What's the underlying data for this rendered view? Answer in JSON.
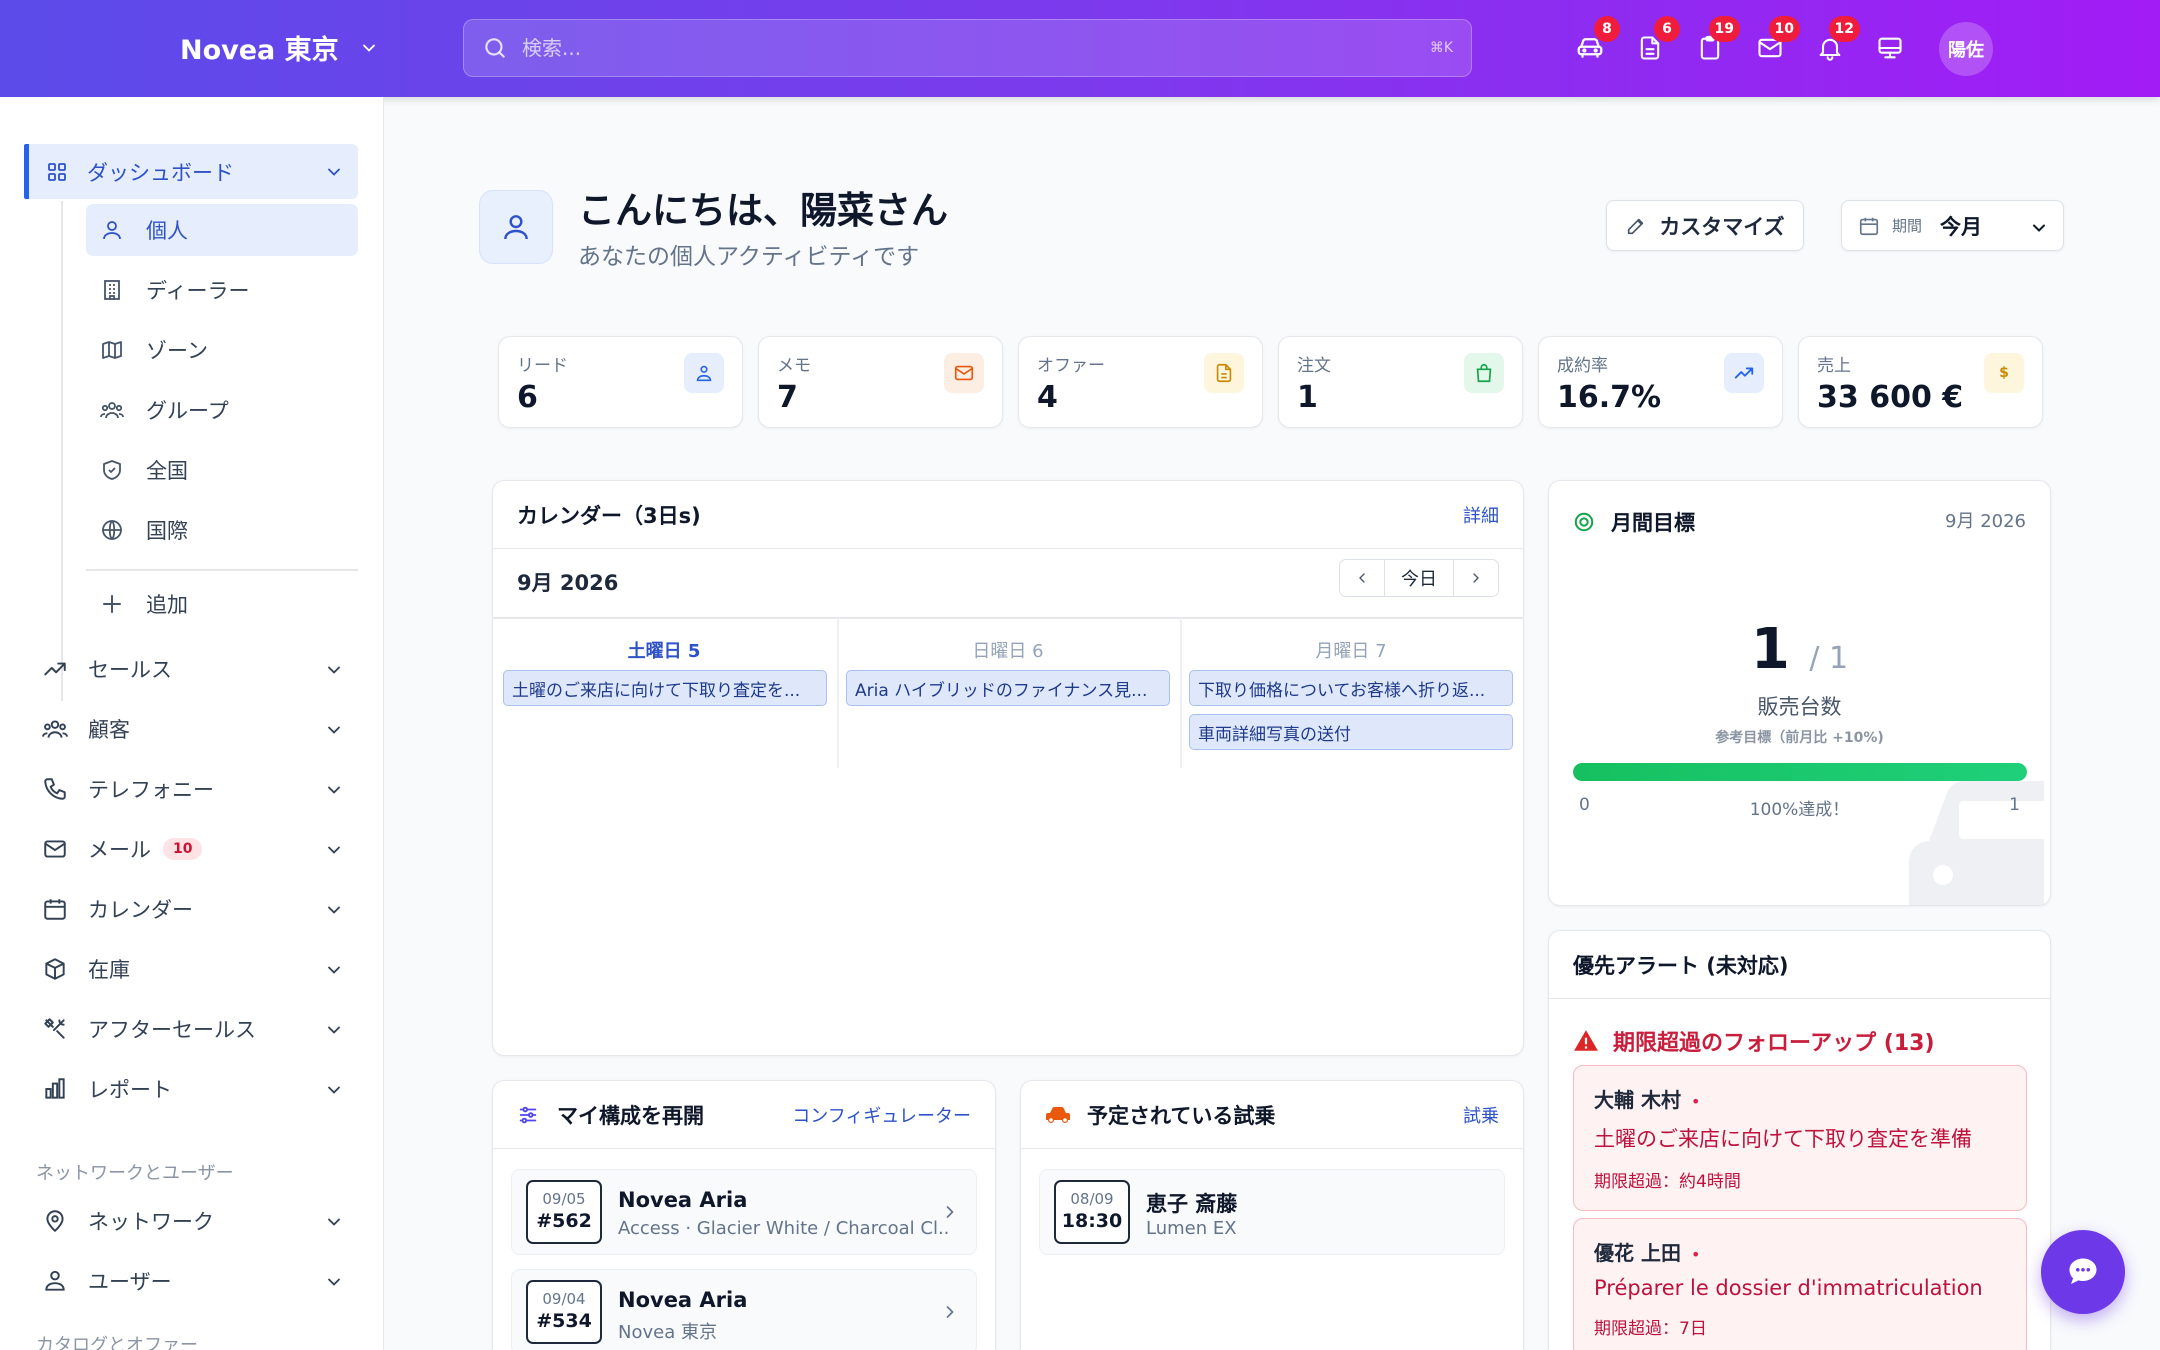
{
  "header": {
    "brand": "Novea 東京",
    "search_placeholder": "検索...",
    "search_kbd": "⌘K",
    "icons": [
      {
        "name": "car-icon",
        "count": "8"
      },
      {
        "name": "document-icon",
        "count": "6"
      },
      {
        "name": "clipboard-icon",
        "count": "19"
      },
      {
        "name": "mail-icon",
        "count": "10"
      },
      {
        "name": "bell-icon",
        "count": "12"
      },
      {
        "name": "monitor-icon",
        "count": ""
      }
    ],
    "user_initials": "陽佐"
  },
  "sidebar": {
    "dashboard": "ダッシュボード",
    "sub_items": [
      "個人",
      "ディーラー",
      "ゾーン",
      "グループ",
      "全国",
      "国際"
    ],
    "add": "追加",
    "nav": [
      "セールス",
      "顧客",
      "テレフォニー",
      "メール",
      "カレンダー",
      "在庫",
      "アフターセールス",
      "レポート"
    ],
    "mail_badge": "10",
    "section_network": "ネットワークとユーザー",
    "network_nav": [
      "ネットワーク",
      "ユーザー"
    ],
    "section_catalog": "カタログとオファー"
  },
  "page": {
    "title": "こんにちは、陽菜さん",
    "subtitle": "あなたの個人アクティビティです",
    "customize": "カスタマイズ",
    "period_label": "期間",
    "period_value": "今月"
  },
  "kpis": [
    {
      "label": "リード",
      "value": "6",
      "color": "#2563eb",
      "bg": "#e6edfc"
    },
    {
      "label": "メモ",
      "value": "7",
      "color": "#ea580c",
      "bg": "#fdeee4"
    },
    {
      "label": "オファー",
      "value": "4",
      "color": "#ca8a04",
      "bg": "#fdf6dc"
    },
    {
      "label": "注文",
      "value": "1",
      "color": "#16a34a",
      "bg": "#e3f7ea"
    },
    {
      "label": "成約率",
      "value": "16.7%",
      "color": "#2563eb",
      "bg": "#e6edfc"
    },
    {
      "label": "売上",
      "value": "33 600 €",
      "color": "#ca8a04",
      "bg": "#fdf6dc"
    }
  ],
  "calendar": {
    "title": "カレンダー（3日s)",
    "link": "詳細",
    "month": "9月 2026",
    "today": "今日",
    "days": [
      "土曜日 5",
      "日曜日 6",
      "月曜日 7"
    ],
    "events": {
      "d0": [
        "土曜のご来店に向けて下取り査定を..."
      ],
      "d1": [
        "Aria ハイブリッドのファイナンス見..."
      ],
      "d2": [
        "下取り価格についてお客様へ折り返...",
        "車両詳細写真の送付"
      ]
    }
  },
  "goal": {
    "title": "月間目標",
    "date": "9月 2026",
    "value": "1",
    "target": "/ 1",
    "label": "販売台数",
    "ref": "参考目標（前月比 +10%)",
    "min": "0",
    "max": "1",
    "progress": 1.0,
    "progress_text": "100%達成！"
  },
  "alerts": {
    "title": "優先アラート (未対応)",
    "group_title": "期限超過のフォローアップ (13)",
    "items": [
      {
        "name": "大輔 木村",
        "dot": "•",
        "text": "土曜のご来店に向けて下取り査定を準備",
        "meta": "期限超過：約4時間"
      },
      {
        "name": "優花 上田",
        "dot": "•",
        "text": "Préparer le dossier d'immatriculation",
        "meta": "期限超過：7日"
      }
    ]
  },
  "configs": {
    "title": "マイ構成を再開",
    "link": "コンフィギュレーター",
    "items": [
      {
        "date": "09/05",
        "num": "#562",
        "title": "Novea Aria",
        "sub": "Access · Glacier White / Charcoal Cl..."
      },
      {
        "date": "09/04",
        "num": "#534",
        "title": "Novea Aria",
        "sub": "Novea 東京"
      }
    ]
  },
  "testdrives": {
    "title": "予定されている試乗",
    "link": "試乗",
    "items": [
      {
        "date": "08/09",
        "time": "18:30",
        "title": "恵子 斎藤",
        "sub": "Lumen EX"
      }
    ]
  }
}
